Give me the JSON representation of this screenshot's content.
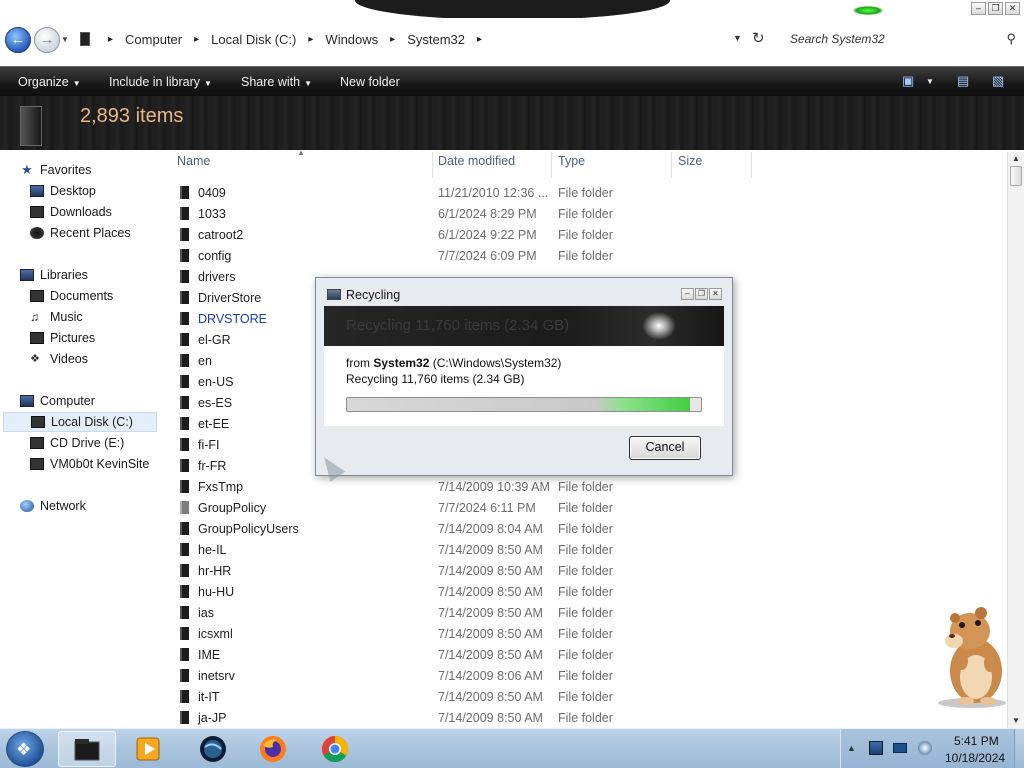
{
  "window": {
    "controls": [
      "–",
      "❐",
      "✕"
    ]
  },
  "address": {
    "crumbs": [
      "Computer",
      "Local Disk (C:)",
      "Windows",
      "System32"
    ],
    "search_placeholder": "Search System32"
  },
  "toolbar": {
    "organize": "Organize",
    "include": "Include in library",
    "share": "Share with",
    "newfolder": "New folder"
  },
  "header": {
    "item_count": "2,893 items"
  },
  "nav": {
    "favorites": "Favorites",
    "desktop": "Desktop",
    "downloads": "Downloads",
    "recent": "Recent Places",
    "libraries": "Libraries",
    "documents": "Documents",
    "music": "Music",
    "pictures": "Pictures",
    "videos": "Videos",
    "computer": "Computer",
    "local_disk": "Local Disk (C:)",
    "cd_drive": "CD Drive (E:)",
    "vmshare": "VM0b0t KevinSite",
    "network": "Network"
  },
  "columns": {
    "name": "Name",
    "date": "Date modified",
    "type": "Type",
    "size": "Size"
  },
  "rows": [
    {
      "name": "0409",
      "date": "11/21/2010 12:36 ...",
      "type": "File folder"
    },
    {
      "name": "1033",
      "date": "6/1/2024 8:29 PM",
      "type": "File folder"
    },
    {
      "name": "catroot2",
      "date": "6/1/2024 9:22 PM",
      "type": "File folder"
    },
    {
      "name": "config",
      "date": "7/7/2024 6:09 PM",
      "type": "File folder"
    },
    {
      "name": "drivers",
      "date": "",
      "type": ""
    },
    {
      "name": "DriverStore",
      "date": "",
      "type": ""
    },
    {
      "name": "DRVSTORE",
      "date": "",
      "type": ""
    },
    {
      "name": "el-GR",
      "date": "",
      "type": ""
    },
    {
      "name": "en",
      "date": "",
      "type": ""
    },
    {
      "name": "en-US",
      "date": "",
      "type": ""
    },
    {
      "name": "es-ES",
      "date": "",
      "type": ""
    },
    {
      "name": "et-EE",
      "date": "",
      "type": ""
    },
    {
      "name": "fi-FI",
      "date": "",
      "type": ""
    },
    {
      "name": "fr-FR",
      "date": "",
      "type": ""
    },
    {
      "name": "FxsTmp",
      "date": "7/14/2009 10:39 AM",
      "type": "File folder"
    },
    {
      "name": "GroupPolicy",
      "date": "7/7/2024 6:11 PM",
      "type": "File folder"
    },
    {
      "name": "GroupPolicyUsers",
      "date": "7/14/2009 8:04 AM",
      "type": "File folder"
    },
    {
      "name": "he-IL",
      "date": "7/14/2009 8:50 AM",
      "type": "File folder"
    },
    {
      "name": "hr-HR",
      "date": "7/14/2009 8:50 AM",
      "type": "File folder"
    },
    {
      "name": "hu-HU",
      "date": "7/14/2009 8:50 AM",
      "type": "File folder"
    },
    {
      "name": "ias",
      "date": "7/14/2009 8:50 AM",
      "type": "File folder"
    },
    {
      "name": "icsxml",
      "date": "7/14/2009 8:50 AM",
      "type": "File folder"
    },
    {
      "name": "IME",
      "date": "7/14/2009 8:50 AM",
      "type": "File folder"
    },
    {
      "name": "inetsrv",
      "date": "7/14/2009 8:06 AM",
      "type": "File folder"
    },
    {
      "name": "it-IT",
      "date": "7/14/2009 8:50 AM",
      "type": "File folder"
    },
    {
      "name": "ja-JP",
      "date": "7/14/2009 8:50 AM",
      "type": "File folder"
    }
  ],
  "dialog": {
    "title": "Recycling",
    "banner": "Recycling 11,760 items (2.34 GB)",
    "from_label": "from",
    "from_name": "System32",
    "from_path": "(C:\\Windows\\System32)",
    "detail": "Recycling 11,760 items (2.34 GB)",
    "progress": 0.97,
    "cancel": "Cancel"
  },
  "taskbar": {
    "time": "5:41 PM",
    "date": "10/18/2024"
  },
  "colors": {
    "toolbar_text": "#f2f2f2",
    "item_count": "#e8b886",
    "progress_green": "#3fcf3f",
    "link_blue": "#1a3fa8"
  }
}
